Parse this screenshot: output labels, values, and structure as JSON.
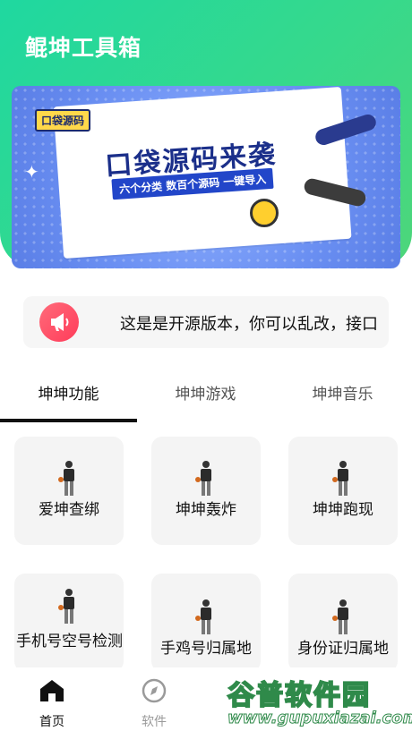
{
  "header": {
    "title": "鲲坤工具箱"
  },
  "banner": {
    "tag": "口袋源码",
    "headline": "口袋源码来袭",
    "subline": "六个分类 数百个源码 一键导入"
  },
  "notice": {
    "text": "这是是开源版本，你可以乱改，接口"
  },
  "tabs": [
    {
      "label": "坤坤功能",
      "active": true
    },
    {
      "label": "坤坤游戏",
      "active": false
    },
    {
      "label": "坤坤音乐",
      "active": false
    }
  ],
  "tiles": [
    {
      "label": "爱坤查绑",
      "icon": "basketball-player-icon"
    },
    {
      "label": "坤坤轰炸",
      "icon": "basketball-player-icon"
    },
    {
      "label": "坤坤跑现",
      "icon": "basketball-player-icon"
    },
    {
      "label": "手机号空号检测",
      "icon": "basketball-player-icon"
    },
    {
      "label": "手鸡号归属地",
      "icon": "basketball-player-icon"
    },
    {
      "label": "身份证归属地",
      "icon": "basketball-player-icon"
    }
  ],
  "bottom_nav": [
    {
      "label": "首页",
      "icon": "home-icon",
      "active": true
    },
    {
      "label": "软件",
      "icon": "compass-icon",
      "active": false
    }
  ],
  "watermark": {
    "big": "谷普软件园",
    "small": "www.gupuxiazai.com"
  },
  "colors": {
    "header_green": "#36d98c",
    "banner_blue": "#6a8ff2",
    "notice_red": "#ff3c5a",
    "tile_bg": "#f4f4f4"
  }
}
